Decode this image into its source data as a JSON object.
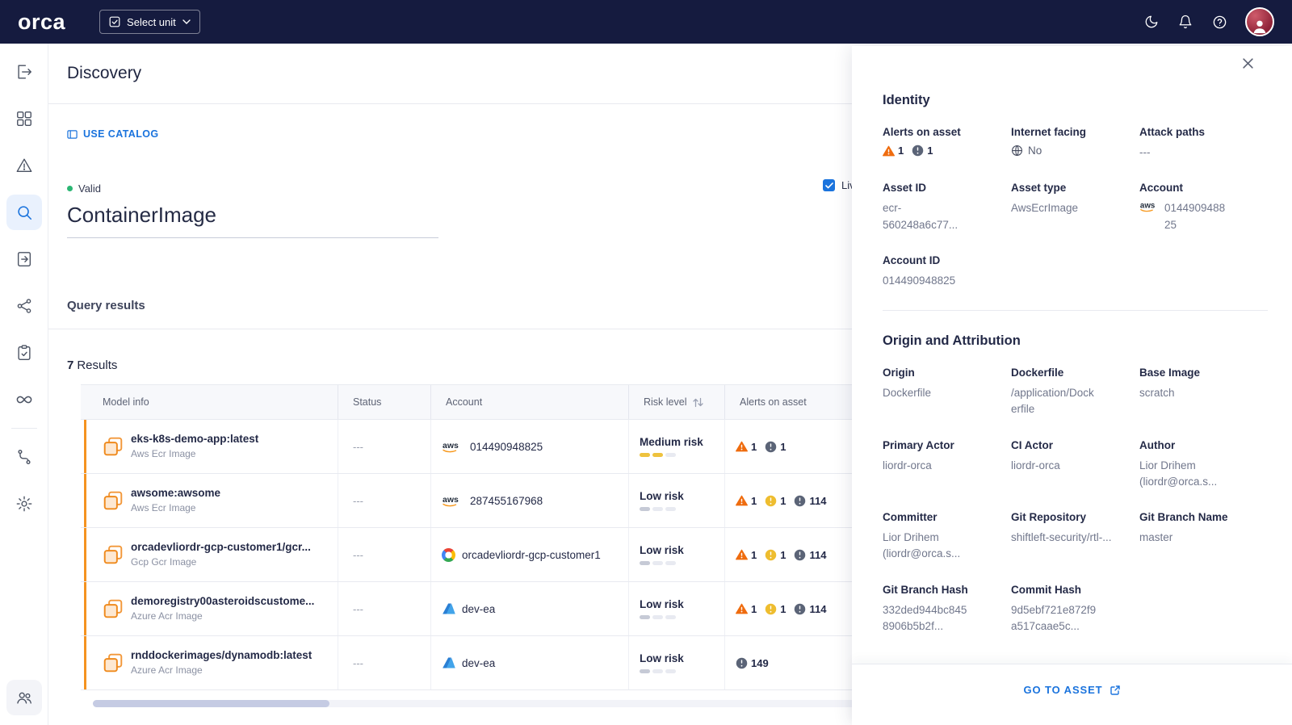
{
  "navbar": {
    "logo": "orca",
    "select_unit_label": "Select unit"
  },
  "sidebar": {
    "items": [
      "gate-icon",
      "dashboard-icon",
      "alerts-icon",
      "search-icon",
      "reports-icon",
      "graph-icon",
      "compliance-icon",
      "infinity-icon",
      "pipeline-icon",
      "settings-icon",
      "users-icon"
    ],
    "active_item": "search-icon"
  },
  "main": {
    "title": "Discovery",
    "use_catalog_label": "USE CATALOG",
    "query": {
      "status": "Valid",
      "value": "ContainerImage",
      "live_label": "Live",
      "live_checked": true
    },
    "results_section_title": "Query results",
    "results_count": "7",
    "results_word": "Results",
    "table": {
      "columns": [
        "Model info",
        "Status",
        "Account",
        "Risk level",
        "Alerts on asset"
      ],
      "rows": [
        {
          "name": "eks-k8s-demo-app:latest",
          "subtitle": "Aws Ecr Image",
          "status": "---",
          "account_provider": "aws",
          "account": "014490948825",
          "risk_label": "Medium risk",
          "risk_level": "medium",
          "alerts": [
            {
              "kind": "warning",
              "count": "1"
            },
            {
              "kind": "info",
              "count": "1"
            }
          ]
        },
        {
          "name": "awsome:awsome",
          "subtitle": "Aws Ecr Image",
          "status": "---",
          "account_provider": "aws",
          "account": "287455167968",
          "risk_label": "Low risk",
          "risk_level": "low",
          "alerts": [
            {
              "kind": "warning",
              "count": "1"
            },
            {
              "kind": "medium",
              "count": "1"
            },
            {
              "kind": "info",
              "count": "114"
            }
          ]
        },
        {
          "name": "orcadevliordr-gcp-customer1/gcr...",
          "subtitle": "Gcp Gcr Image",
          "status": "---",
          "account_provider": "gcp",
          "account": "orcadevliordr-gcp-customer1",
          "risk_label": "Low risk",
          "risk_level": "low",
          "alerts": [
            {
              "kind": "warning",
              "count": "1"
            },
            {
              "kind": "medium",
              "count": "1"
            },
            {
              "kind": "info",
              "count": "114"
            }
          ]
        },
        {
          "name": "demoregistry00asteroidscustome...",
          "subtitle": "Azure Acr Image",
          "status": "---",
          "account_provider": "azure",
          "account": "dev-ea",
          "risk_label": "Low risk",
          "risk_level": "low",
          "alerts": [
            {
              "kind": "warning",
              "count": "1"
            },
            {
              "kind": "medium",
              "count": "1"
            },
            {
              "kind": "info",
              "count": "114"
            }
          ]
        },
        {
          "name": "rnddockerimages/dynamodb:latest",
          "subtitle": "Azure Acr Image",
          "status": "---",
          "account_provider": "azure",
          "account": "dev-ea",
          "risk_label": "Low risk",
          "risk_level": "low",
          "alerts": [
            {
              "kind": "info",
              "count": "149"
            }
          ]
        }
      ]
    }
  },
  "panel": {
    "identity": {
      "title": "Identity",
      "alerts_label": "Alerts on asset",
      "alerts": [
        {
          "kind": "warning",
          "count": "1"
        },
        {
          "kind": "info",
          "count": "1"
        }
      ],
      "internet_facing_label": "Internet facing",
      "internet_facing_value": "No",
      "attack_paths_label": "Attack paths",
      "attack_paths_value": "---",
      "asset_id_label": "Asset ID",
      "asset_id_value": "ecr-560248a6c77...",
      "asset_type_label": "Asset type",
      "asset_type_value": "AwsEcrImage",
      "account_label": "Account",
      "account_value": "014490948825",
      "account_id_label": "Account ID",
      "account_id_value": "014490948825"
    },
    "origin": {
      "title": "Origin and Attribution",
      "fields": [
        {
          "label": "Origin",
          "value": "Dockerfile"
        },
        {
          "label": "Dockerfile",
          "value": "/application/Dockerfile"
        },
        {
          "label": "Base Image",
          "value": "scratch"
        },
        {
          "label": "Primary Actor",
          "value": "liordr-orca"
        },
        {
          "label": "CI Actor",
          "value": "liordr-orca"
        },
        {
          "label": "Author",
          "value": "Lior Drihem (liordr@orca.s..."
        },
        {
          "label": "Committer",
          "value": "Lior Drihem (liordr@orca.s..."
        },
        {
          "label": "Git Repository",
          "value": "shiftleft-security/rtl-..."
        },
        {
          "label": "Git Branch Name",
          "value": "master"
        },
        {
          "label": "Git Branch Hash",
          "value": "332ded944bc8458906b5b2f..."
        },
        {
          "label": "Commit Hash",
          "value": "9d5ebf721e872f9a517caae5c..."
        }
      ]
    },
    "go_to_asset_label": "GO TO ASSET"
  },
  "colors": {
    "navbar_bg": "#151b3f",
    "accent_blue": "#1a73dd",
    "warning_orange": "#ef6c0f",
    "medium_yellow": "#eebd2f",
    "info_slate": "#5b6477",
    "risk_meter_yellow": "#eec23e",
    "valid_green": "#2bb673",
    "row_accent_orange": "#f59320"
  }
}
